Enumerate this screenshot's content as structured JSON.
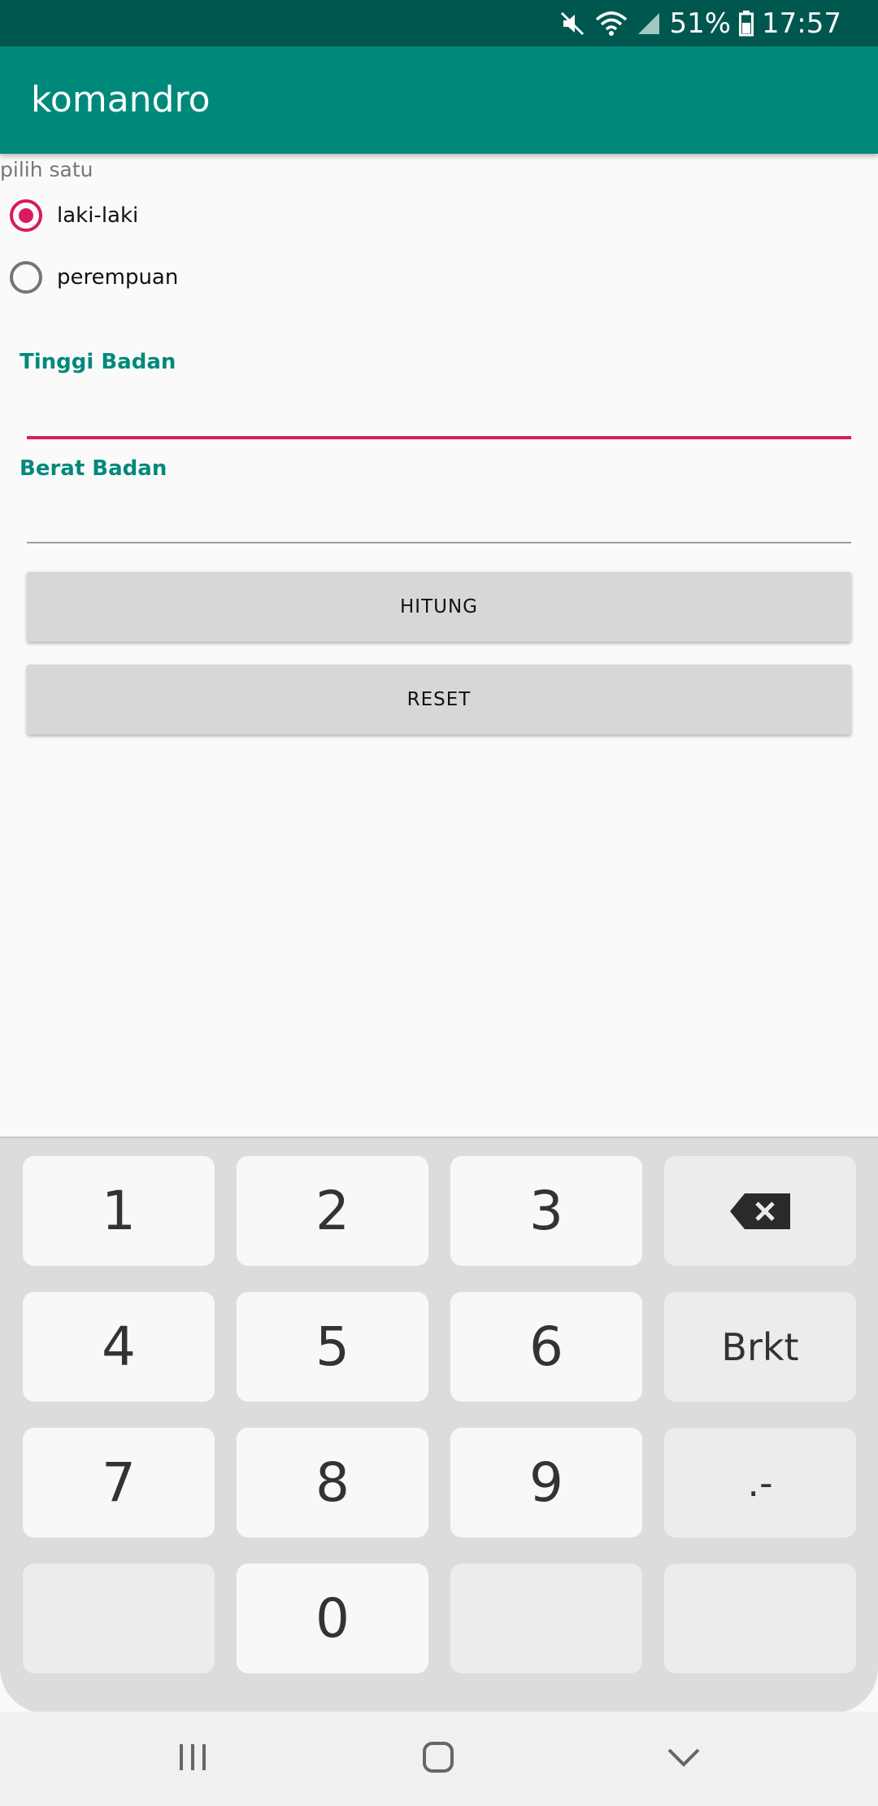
{
  "status_bar": {
    "battery": "51%",
    "time": "17:57",
    "icons": [
      "mute-icon",
      "wifi-icon",
      "signal-icon",
      "battery-icon"
    ]
  },
  "app_bar": {
    "title": "komandro"
  },
  "gender_group": {
    "label": "pilih satu",
    "options": [
      {
        "label": "laki-laki",
        "checked": true
      },
      {
        "label": "perempuan",
        "checked": false
      }
    ]
  },
  "fields": {
    "height": {
      "label": "Tinggi Badan",
      "value": "",
      "focused": true
    },
    "weight": {
      "label": "Berat Badan",
      "value": "",
      "focused": false
    }
  },
  "buttons": {
    "calculate": "HITUNG",
    "reset": "RESET"
  },
  "keyboard": {
    "rows": [
      [
        "1",
        "2",
        "3",
        "backspace-icon"
      ],
      [
        "4",
        "5",
        "6",
        "Brkt"
      ],
      [
        "7",
        "8",
        "9",
        ".-"
      ],
      [
        "",
        "0",
        "",
        ""
      ]
    ]
  },
  "nav_bar": {
    "icons": [
      "recents-icon",
      "home-icon",
      "back-icon"
    ]
  },
  "colors": {
    "status_bar": "#00574f",
    "app_bar": "#00897b",
    "accent": "#d81b60",
    "label_teal": "#00897b",
    "button": "#d6d7d7",
    "keyboard_bg": "#dcdcdc"
  }
}
